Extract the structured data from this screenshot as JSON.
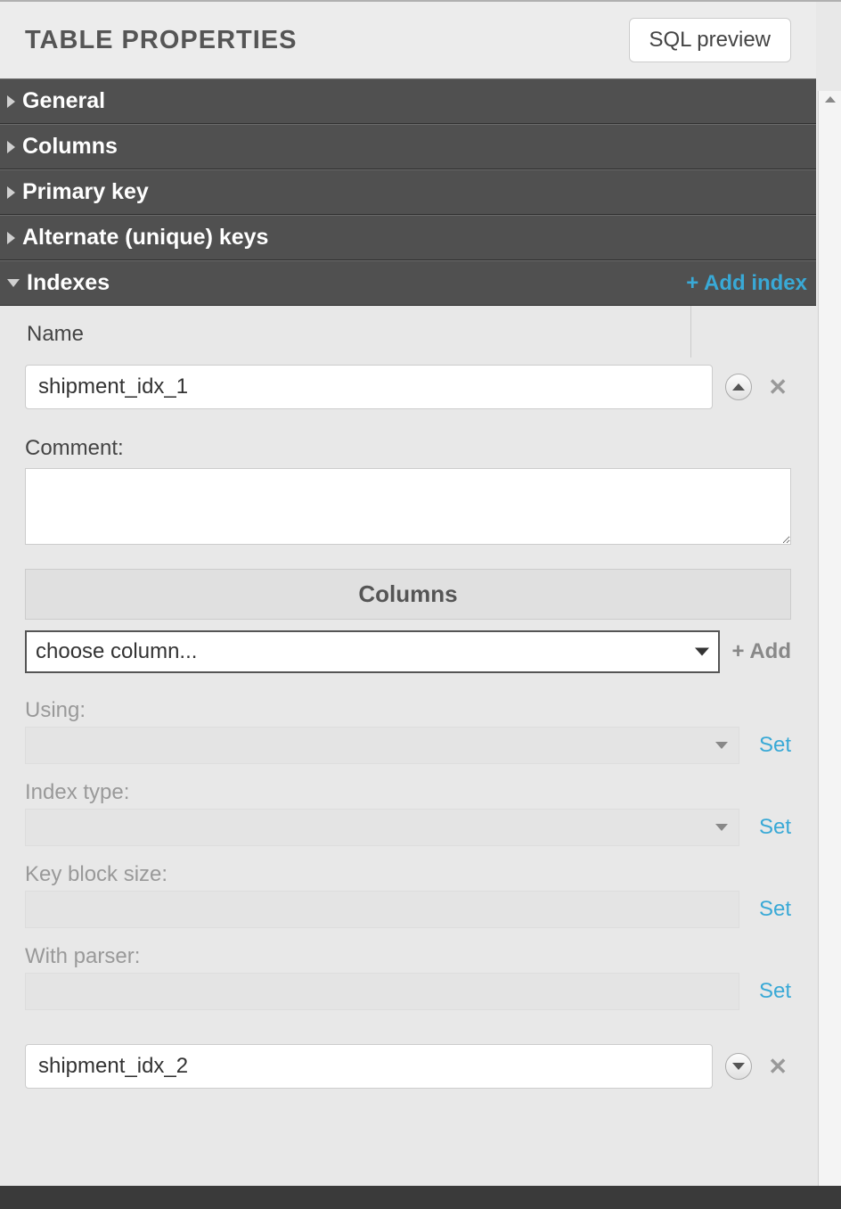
{
  "header": {
    "title": "TABLE PROPERTIES",
    "sql_preview_label": "SQL preview"
  },
  "sections": {
    "general": "General",
    "columns": "Columns",
    "primary_key": "Primary key",
    "alternate_keys": "Alternate (unique) keys",
    "indexes": "Indexes",
    "add_index_label": "+ Add index"
  },
  "name_column_header": "Name",
  "indexes": [
    {
      "name": "shipment_idx_1",
      "expanded": true
    },
    {
      "name": "shipment_idx_2",
      "expanded": false
    }
  ],
  "detail": {
    "comment_label": "Comment:",
    "comment_value": "",
    "columns_header": "Columns",
    "choose_column_placeholder": "choose column...",
    "add_column_label": "+ Add",
    "using_label": "Using:",
    "index_type_label": "Index type:",
    "key_block_size_label": "Key block size:",
    "with_parser_label": "With parser:",
    "set_label": "Set"
  }
}
